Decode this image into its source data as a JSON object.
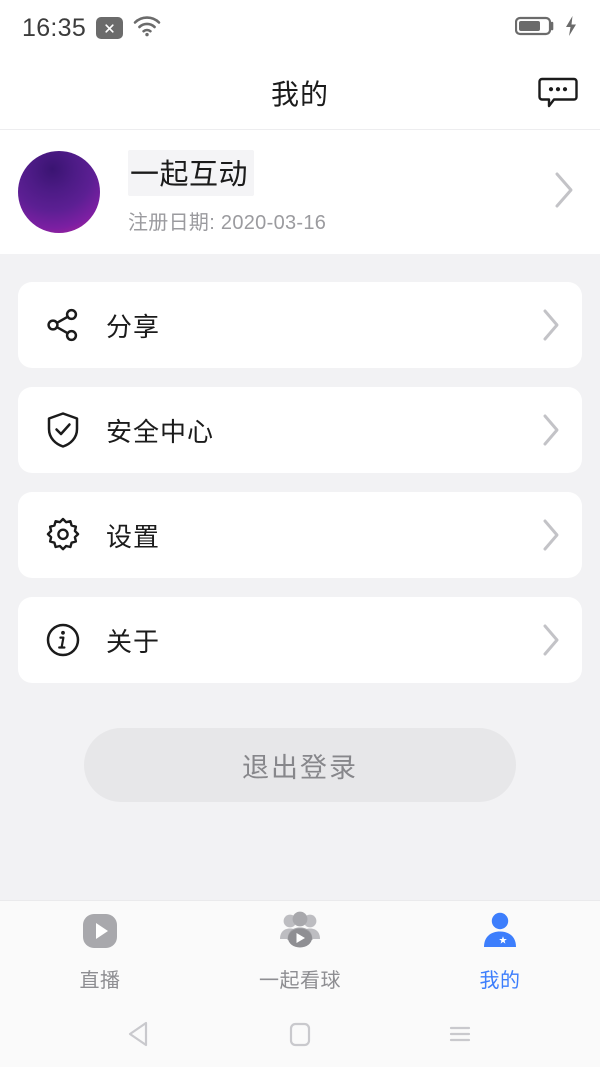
{
  "status_bar": {
    "time": "16:35",
    "badge_icon": "close-badge-icon",
    "wifi_icon": "wifi-icon",
    "battery_icon": "battery-icon",
    "charging_icon": "charging-bolt-icon",
    "battery_level": "65"
  },
  "header": {
    "title": "我的",
    "action_icon": "message-bubble-icon"
  },
  "profile": {
    "avatar_icon": "avatar",
    "avatar_gradient_from": "#3a1472",
    "avatar_gradient_to": "#c2359b",
    "username": "一起互动",
    "register_label": "注册日期: 2020-03-16",
    "chevron_icon": "chevron-right-icon"
  },
  "menu": {
    "items": [
      {
        "label": "分享",
        "icon": "share-icon",
        "chevron": "chevron-right-icon"
      },
      {
        "label": "安全中心",
        "icon": "shield-check-icon",
        "chevron": "chevron-right-icon"
      },
      {
        "label": "设置",
        "icon": "gear-icon",
        "chevron": "chevron-right-icon"
      },
      {
        "label": "关于",
        "icon": "info-circle-icon",
        "chevron": "chevron-right-icon"
      }
    ]
  },
  "logout": {
    "label": "退出登录"
  },
  "tabbar": {
    "active_color": "#3d7efc",
    "inactive_color": "#8e8e92",
    "tabs": [
      {
        "label": "直播",
        "icon": "live-play-icon",
        "active": false
      },
      {
        "label": "一起看球",
        "icon": "watch-together-icon",
        "active": false
      },
      {
        "label": "我的",
        "icon": "profile-person-star-icon",
        "active": true
      }
    ]
  },
  "system_nav": {
    "back_icon": "back-triangle-icon",
    "home_icon": "home-square-icon",
    "recents_icon": "recents-lines-icon"
  }
}
